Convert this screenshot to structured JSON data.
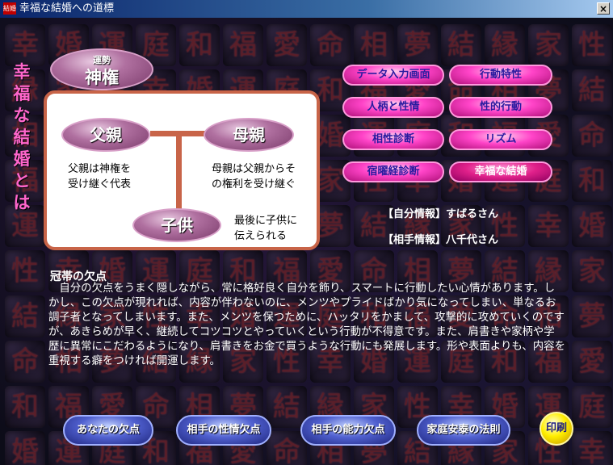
{
  "window": {
    "app_icon_text": "結婚",
    "title": "幸福な結婚への道標",
    "close_label": "×"
  },
  "background_glyphs": [
    "幸",
    "福",
    "結",
    "婚",
    "愛",
    "縁",
    "運",
    "命",
    "家",
    "庭",
    "相",
    "性",
    "和",
    "夢"
  ],
  "side_title": "幸福な結婚とは",
  "diagram": {
    "top_small": "運勢",
    "top": "神権",
    "father": "父親",
    "mother": "母親",
    "child": "子供",
    "father_text_1": "父親は神権を",
    "father_text_2": "受け継ぐ代表",
    "mother_text_1": "母親は父親からそ",
    "mother_text_2": "の権利を受け継ぐ",
    "child_text_1": "最後に子供に",
    "child_text_2": "伝えられる"
  },
  "menu": {
    "data_entry": "データ入力画面",
    "behavior": "行動特性",
    "personality": "人柄と性情",
    "sexual": "性的行動",
    "compat": "相性診断",
    "rhythm": "リズム",
    "sukuyo": "宿曜経診断",
    "happy_marriage": "幸福な結婚"
  },
  "info": {
    "self": "【自分情報】すばるさん",
    "partner": "【相手情報】八千代さん"
  },
  "description": {
    "title": "冠帯の欠点",
    "body": "自分の欠点をうまく隠しながら、常に格好良く自分を飾り、スマートに行動したい心情があります。しかし、この欠点が現れれば、内容が伴わないのに、メンツやプライドばかり気になってしまい、単なるお調子者となってしまいます。また、メンツを保つために、ハッタリをかまして、攻撃的に攻めていくのですが、あきらめが早く、継続してコツコツとやっていくという行動が不得意です。また、肩書きや家柄や学歴に異常にこだわるようになり、肩書きをお金で買うような行動にも発展します。形や表面よりも、内容を重視する癖をつければ開運します。"
  },
  "bottom": {
    "your_fault": "あなたの欠点",
    "partner_character_fault": "相手の性情欠点",
    "partner_ability_fault": "相手の能力欠点",
    "family_law": "家庭安泰の法則",
    "print": "印刷"
  },
  "colors": {
    "accent_pink": "#ff44c8",
    "panel_border": "#c86448",
    "side_title": "#ff66cc"
  }
}
